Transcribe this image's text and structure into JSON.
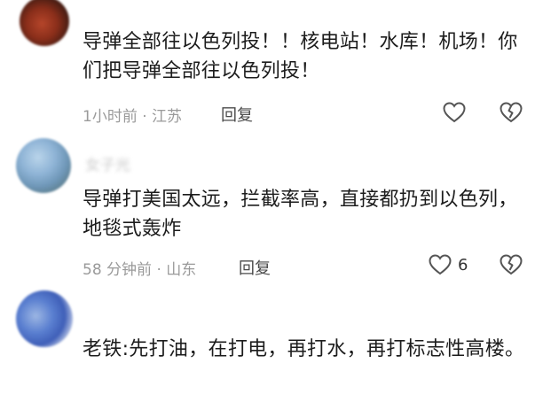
{
  "comments": [
    {
      "username": "",
      "text": "导弹全部往以色列投！！核电站！水库！机场！你们把导弹全部往以色列投！",
      "time": "1小时前",
      "location": "江苏",
      "reply_label": "回复",
      "like_count": "",
      "like_icon": "heart-outline-icon",
      "dislike_icon": "broken-heart-icon"
    },
    {
      "username": "女子光",
      "text": "导弹打美国太远，拦截率高，直接都扔到以色列，地毯式轰炸",
      "time": "58 分钟前",
      "location": "山东",
      "reply_label": "回复",
      "like_count": "6",
      "like_icon": "heart-outline-icon",
      "dislike_icon": "broken-heart-icon"
    },
    {
      "username": "",
      "text": "老铁:先打油，在打电，再打水，再打标志性高楼。",
      "time": "",
      "location": "",
      "reply_label": "",
      "like_count": "",
      "like_icon": "heart-outline-icon",
      "dislike_icon": "broken-heart-icon"
    }
  ],
  "meta_separator": "·",
  "colors": {
    "text": "#1c1c1c",
    "meta": "#9a9a9a",
    "icon": "#555555"
  }
}
